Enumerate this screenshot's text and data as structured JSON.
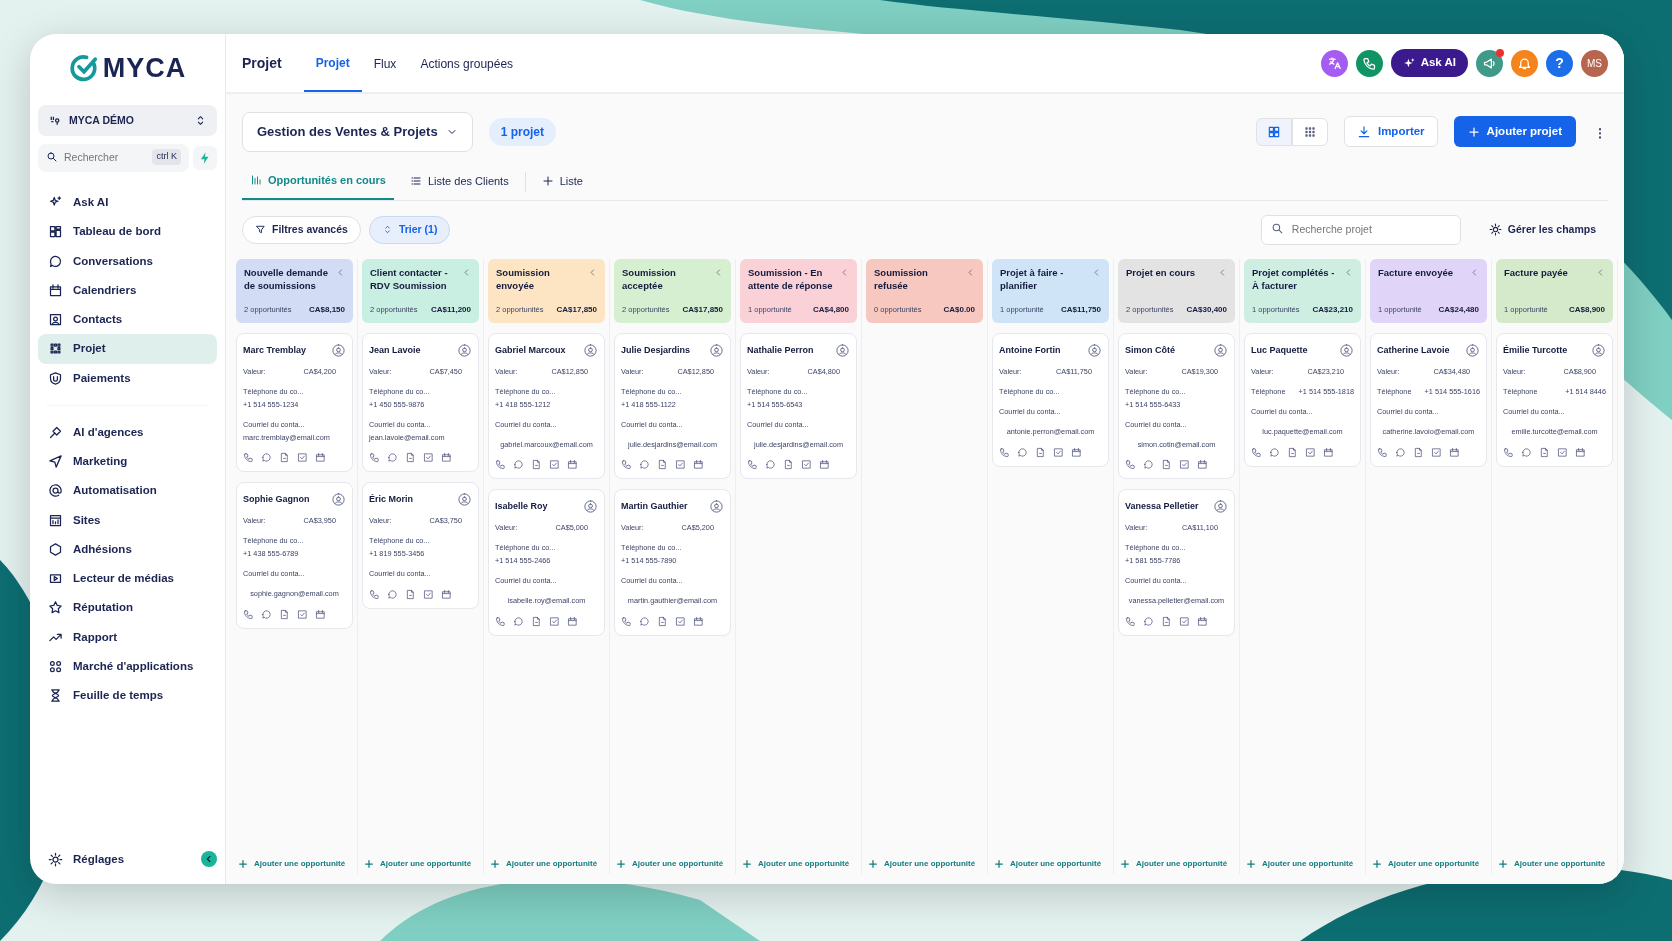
{
  "brand": {
    "name": "MYCA"
  },
  "workspace": {
    "name": "MYCA DÉMO"
  },
  "search": {
    "placeholder": "Rechercher",
    "shortcut": "ctrl K"
  },
  "sidebar": {
    "groups": [
      [
        {
          "label": "Ask AI",
          "selected": false
        },
        {
          "label": "Tableau de bord",
          "selected": false
        },
        {
          "label": "Conversations",
          "selected": false
        },
        {
          "label": "Calendriers",
          "selected": false
        },
        {
          "label": "Contacts",
          "selected": false
        },
        {
          "label": "Projet",
          "selected": true
        },
        {
          "label": "Paiements",
          "selected": false
        }
      ],
      [
        {
          "label": "AI d'agences",
          "selected": false
        },
        {
          "label": "Marketing",
          "selected": false
        },
        {
          "label": "Automatisation",
          "selected": false
        },
        {
          "label": "Sites",
          "selected": false
        },
        {
          "label": "Adhésions",
          "selected": false
        },
        {
          "label": "Lecteur de médias",
          "selected": false
        },
        {
          "label": "Réputation",
          "selected": false
        },
        {
          "label": "Rapport",
          "selected": false
        },
        {
          "label": "Marché d'applications",
          "selected": false
        },
        {
          "label": "Feuille de temps",
          "selected": false
        }
      ]
    ],
    "footer": {
      "label": "Réglages"
    }
  },
  "header": {
    "title": "Projet",
    "tabs": [
      {
        "label": "Projet",
        "selected": true
      },
      {
        "label": "Flux",
        "selected": false
      },
      {
        "label": "Actions groupées",
        "selected": false
      }
    ],
    "ask_ai": "Ask AI",
    "help": "?",
    "avatar": "MS",
    "notification_dot": true
  },
  "pipeline": {
    "name": "Gestion des Ventes & Projets",
    "count": "1 projet"
  },
  "view_toggle": [
    {
      "selected": true
    },
    {
      "selected": false
    }
  ],
  "import_button": "Importer",
  "add_button": "Ajouter projet",
  "views": [
    {
      "label": "Opportunités en cours",
      "selected": true
    },
    {
      "label": "Liste des Clients",
      "selected": false
    }
  ],
  "add_view": "Liste",
  "filters": {
    "advanced": "Filtres avancés",
    "sort": "Trier (1)",
    "search_placeholder": "Recherche projet",
    "fields": "Gérer les champs"
  },
  "columns": [
    {
      "title": "Nouvelle demande de soumissions",
      "color": "#d3dcf5",
      "count": "2 opportunités",
      "total": "CA$8,150",
      "add_label": "Ajouter une opportunité",
      "cards": [
        {
          "name": "Marc Tremblay",
          "value_label": "Valeur:",
          "value": "CA$4,200",
          "phone_label": "Téléphone du co...",
          "phone": "+1 514 555-1234",
          "email_label": "Courriel du conta...",
          "email": "marc.tremblay@email.com",
          "email_inline": true
        },
        {
          "name": "Sophie Gagnon",
          "value_label": "Valeur:",
          "value": "CA$3,950",
          "phone_label": "Téléphone du co...",
          "phone": "+1 438 555-6789",
          "email_label": "Courriel du conta...",
          "email": "sophie.gagnon@email.com",
          "email_inline": false
        }
      ]
    },
    {
      "title": "Client contacter - RDV Soumission",
      "color": "#c9eee2",
      "count": "2 opportunités",
      "total": "CA$11,200",
      "add_label": "Ajouter une opportunité",
      "cards": [
        {
          "name": "Jean Lavoie",
          "value_label": "Valeur:",
          "value": "CA$7,450",
          "phone_label": "Téléphone du co...",
          "phone": "+1 450 555-9876",
          "email_label": "Courriel du conta...",
          "email": "jean.lavoie@email.com",
          "email_inline": true
        },
        {
          "name": "Éric Morin",
          "value_label": "Valeur:",
          "value": "CA$3,750",
          "phone_label": "Téléphone du co...",
          "phone": "+1 819 555-3456",
          "email_label": "Courriel du conta..."
        }
      ]
    },
    {
      "title": "Soumission envoyée",
      "color": "#fde5c4",
      "count": "2 opportunités",
      "total": "CA$17,850",
      "add_label": "Ajouter une opportunité",
      "cards": [
        {
          "name": "Gabriel Marcoux",
          "value_label": "Valeur:",
          "value": "CA$12,850",
          "phone_label": "Téléphone du co...",
          "phone": "+1 418 555-1212",
          "email_label": "Courriel du conta...",
          "email": "gabriel.marcoux@email.com",
          "email_inline": false
        },
        {
          "name": "Isabelle Roy",
          "value_label": "Valeur:",
          "value": "CA$5,000",
          "phone_label": "Téléphone du co...",
          "phone": "+1 514 555-2466",
          "email_label": "Courriel du conta...",
          "email": "isabelle.roy@email.com",
          "email_inline": false
        }
      ]
    },
    {
      "title": "Soumission acceptée",
      "color": "#d7efd1",
      "count": "2 opportunités",
      "total": "CA$17,850",
      "add_label": "Ajouter une opportunité",
      "cards": [
        {
          "name": "Julie Desjardins",
          "value_label": "Valeur:",
          "value": "CA$12,850",
          "phone_label": "Téléphone du co...",
          "phone": "+1 418 555-1122",
          "email_label": "Courriel du conta...",
          "email": "julie.desjardins@email.com",
          "email_inline": false
        },
        {
          "name": "Martin Gauthier",
          "value_label": "Valeur:",
          "value": "CA$5,200",
          "phone_label": "Téléphone du co...",
          "phone": "+1 514 555-7890",
          "email_label": "Courriel du conta...",
          "email": "martin.gauthier@email.com",
          "email_inline": false
        }
      ]
    },
    {
      "title": "Soumission - En attente de réponse",
      "color": "#fbd1d8",
      "count": "1 opportunité",
      "total": "CA$4,800",
      "add_label": "Ajouter une opportunité",
      "cards": [
        {
          "name": "Nathalie Perron",
          "value_label": "Valeur:",
          "value": "CA$4,800",
          "phone_label": "Téléphone du co...",
          "phone": "+1 514 555-6543",
          "email_label": "Courriel du conta...",
          "email": "julie.desjardins@email.com",
          "email_inline": false
        }
      ]
    },
    {
      "title": "Soumission refusée",
      "color": "#f7c8c0",
      "count": "0 opportunités",
      "total": "CA$0.00",
      "add_label": "Ajouter une opportunité"
    },
    {
      "title": "Projet à faire - planifier",
      "color": "#cfe5f7",
      "count": "1 opportunité",
      "total": "CA$11,750",
      "add_label": "Ajouter une opportunité",
      "cards": [
        {
          "name": "Antoine Fortin",
          "value_label": "Valeur:",
          "value": "CA$11,750",
          "phone_label": "Téléphone du co...",
          "email_label": "Courriel du conta...",
          "email": "antonie.perron@email.com",
          "email_inline": false
        }
      ]
    },
    {
      "title": "Projet en cours",
      "color": "#e3e3e3",
      "count": "2 opportunités",
      "total": "CA$30,400",
      "add_label": "Ajouter une opportunité",
      "cards": [
        {
          "name": "Simon Côté",
          "value_label": "Valeur:",
          "value": "CA$19,300",
          "phone_label": "Téléphone du co...",
          "phone": "+1 514 555-6433",
          "email_label": "Courriel du conta...",
          "email": "simon.cotin@email.com",
          "email_inline": false
        },
        {
          "name": "Vanessa Pelletier",
          "value_label": "Valeur:",
          "value": "CA$11,100",
          "phone_label": "Téléphone du co...",
          "phone": "+1 581 555-7786",
          "email_label": "Courriel du conta...",
          "email": "vanessa.pelletier@email.com",
          "email_inline": false
        }
      ]
    },
    {
      "title": "Projet complétés - À facturer",
      "color": "#cdeee1",
      "count": "1 opportunités",
      "total": "CA$23,210",
      "add_label": "Ajouter une opportunité",
      "cards": [
        {
          "name": "Luc Paquette",
          "value_label": "Valeur:",
          "value": "CA$23,210",
          "phone_label": "Téléphone",
          "phone": "+1 514 555-1818",
          "email_label": "Courriel du conta...",
          "email": "luc.paquette@email.com",
          "email_inline": false
        }
      ]
    },
    {
      "title": "Facture envoyée",
      "color": "#e0d5f8",
      "count": "1 opportunité",
      "total": "CA$24,480",
      "add_label": "Ajouter une opportunité",
      "cards": [
        {
          "name": "Catherine Lavoie",
          "value_label": "Valeur:",
          "value": "CA$34,480",
          "phone_label": "Téléphone",
          "phone": "+1 514 555-1616",
          "email_label": "Courriel du conta...",
          "email": "catherine.lavoio@email.com",
          "email_inline": false
        }
      ]
    },
    {
      "title": "Facture payée",
      "color": "#d5eacb",
      "count": "1 opportunité",
      "total": "CA$8,900",
      "add_label": "Ajouter une opportunité",
      "cards": [
        {
          "name": "Émilie Turcotte",
          "value_label": "Valeur:",
          "value": "CA$8,900",
          "phone_label": "Téléphone",
          "phone": "+1 514 8446",
          "email_label": "Courriel du conta...",
          "email": "emilie.turcotte@email.com",
          "email_inline": false
        }
      ]
    }
  ]
}
